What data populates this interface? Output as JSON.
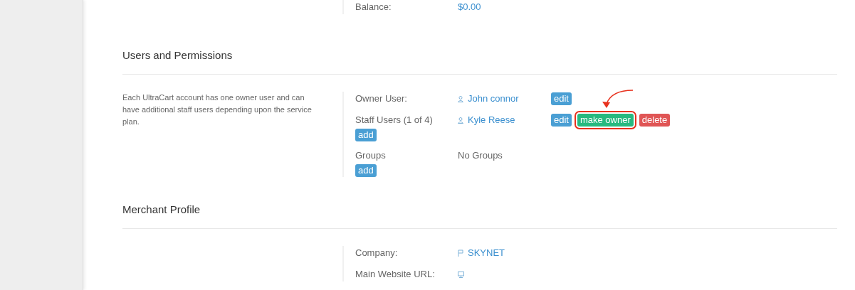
{
  "balance": {
    "label": "Balance:",
    "value": "$0.00"
  },
  "sections": [
    {
      "title": "Users and Permissions",
      "description": "Each UltraCart account has one owner user and can have additional staff users depending upon the service plan.",
      "rows": [
        {
          "label": "Owner User:",
          "value": "John connor",
          "kind": "user",
          "actions": [
            {
              "label": "edit",
              "kind": "edit",
              "highlighted": false
            }
          ]
        },
        {
          "label": "Staff Users (1 of 4)",
          "value": "Kyle Reese",
          "kind": "user",
          "actions": [
            {
              "label": "edit",
              "kind": "edit",
              "highlighted": false
            },
            {
              "label": "make owner",
              "kind": "make_owner",
              "highlighted": true
            },
            {
              "label": "delete",
              "kind": "delete",
              "highlighted": false
            }
          ],
          "add": "add"
        },
        {
          "label": "Groups",
          "value": "No Groups",
          "kind": "plain",
          "add": "add"
        }
      ]
    },
    {
      "title": "Merchant Profile",
      "rows": [
        {
          "label": "Company:",
          "value": "SKYNET",
          "kind": "company"
        },
        {
          "label": "Main Website URL:",
          "kind": "website"
        }
      ]
    }
  ]
}
